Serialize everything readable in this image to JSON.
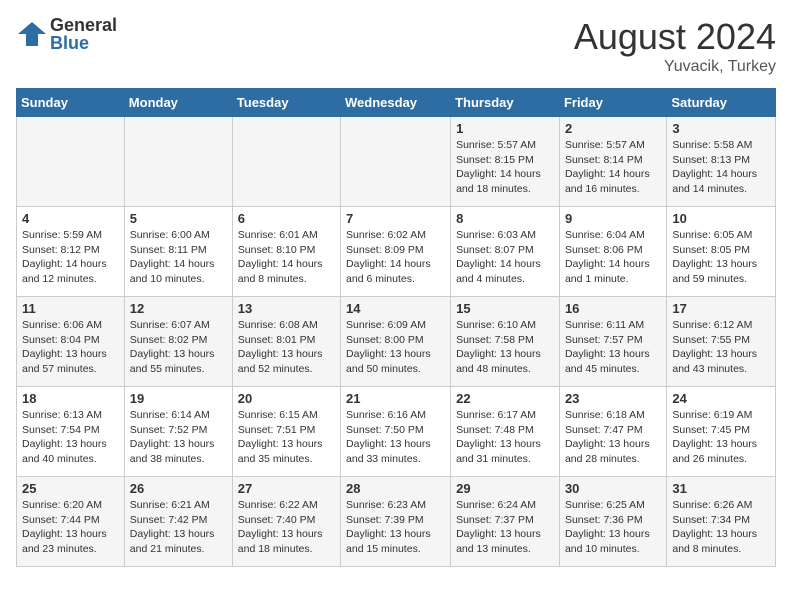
{
  "logo": {
    "general": "General",
    "blue": "Blue"
  },
  "title": "August 2024",
  "location": "Yuvacik, Turkey",
  "days_of_week": [
    "Sunday",
    "Monday",
    "Tuesday",
    "Wednesday",
    "Thursday",
    "Friday",
    "Saturday"
  ],
  "weeks": [
    [
      {
        "day": "",
        "content": ""
      },
      {
        "day": "",
        "content": ""
      },
      {
        "day": "",
        "content": ""
      },
      {
        "day": "",
        "content": ""
      },
      {
        "day": "1",
        "content": "Sunrise: 5:57 AM\nSunset: 8:15 PM\nDaylight: 14 hours\nand 18 minutes."
      },
      {
        "day": "2",
        "content": "Sunrise: 5:57 AM\nSunset: 8:14 PM\nDaylight: 14 hours\nand 16 minutes."
      },
      {
        "day": "3",
        "content": "Sunrise: 5:58 AM\nSunset: 8:13 PM\nDaylight: 14 hours\nand 14 minutes."
      }
    ],
    [
      {
        "day": "4",
        "content": "Sunrise: 5:59 AM\nSunset: 8:12 PM\nDaylight: 14 hours\nand 12 minutes."
      },
      {
        "day": "5",
        "content": "Sunrise: 6:00 AM\nSunset: 8:11 PM\nDaylight: 14 hours\nand 10 minutes."
      },
      {
        "day": "6",
        "content": "Sunrise: 6:01 AM\nSunset: 8:10 PM\nDaylight: 14 hours\nand 8 minutes."
      },
      {
        "day": "7",
        "content": "Sunrise: 6:02 AM\nSunset: 8:09 PM\nDaylight: 14 hours\nand 6 minutes."
      },
      {
        "day": "8",
        "content": "Sunrise: 6:03 AM\nSunset: 8:07 PM\nDaylight: 14 hours\nand 4 minutes."
      },
      {
        "day": "9",
        "content": "Sunrise: 6:04 AM\nSunset: 8:06 PM\nDaylight: 14 hours\nand 1 minute."
      },
      {
        "day": "10",
        "content": "Sunrise: 6:05 AM\nSunset: 8:05 PM\nDaylight: 13 hours\nand 59 minutes."
      }
    ],
    [
      {
        "day": "11",
        "content": "Sunrise: 6:06 AM\nSunset: 8:04 PM\nDaylight: 13 hours\nand 57 minutes."
      },
      {
        "day": "12",
        "content": "Sunrise: 6:07 AM\nSunset: 8:02 PM\nDaylight: 13 hours\nand 55 minutes."
      },
      {
        "day": "13",
        "content": "Sunrise: 6:08 AM\nSunset: 8:01 PM\nDaylight: 13 hours\nand 52 minutes."
      },
      {
        "day": "14",
        "content": "Sunrise: 6:09 AM\nSunset: 8:00 PM\nDaylight: 13 hours\nand 50 minutes."
      },
      {
        "day": "15",
        "content": "Sunrise: 6:10 AM\nSunset: 7:58 PM\nDaylight: 13 hours\nand 48 minutes."
      },
      {
        "day": "16",
        "content": "Sunrise: 6:11 AM\nSunset: 7:57 PM\nDaylight: 13 hours\nand 45 minutes."
      },
      {
        "day": "17",
        "content": "Sunrise: 6:12 AM\nSunset: 7:55 PM\nDaylight: 13 hours\nand 43 minutes."
      }
    ],
    [
      {
        "day": "18",
        "content": "Sunrise: 6:13 AM\nSunset: 7:54 PM\nDaylight: 13 hours\nand 40 minutes."
      },
      {
        "day": "19",
        "content": "Sunrise: 6:14 AM\nSunset: 7:52 PM\nDaylight: 13 hours\nand 38 minutes."
      },
      {
        "day": "20",
        "content": "Sunrise: 6:15 AM\nSunset: 7:51 PM\nDaylight: 13 hours\nand 35 minutes."
      },
      {
        "day": "21",
        "content": "Sunrise: 6:16 AM\nSunset: 7:50 PM\nDaylight: 13 hours\nand 33 minutes."
      },
      {
        "day": "22",
        "content": "Sunrise: 6:17 AM\nSunset: 7:48 PM\nDaylight: 13 hours\nand 31 minutes."
      },
      {
        "day": "23",
        "content": "Sunrise: 6:18 AM\nSunset: 7:47 PM\nDaylight: 13 hours\nand 28 minutes."
      },
      {
        "day": "24",
        "content": "Sunrise: 6:19 AM\nSunset: 7:45 PM\nDaylight: 13 hours\nand 26 minutes."
      }
    ],
    [
      {
        "day": "25",
        "content": "Sunrise: 6:20 AM\nSunset: 7:44 PM\nDaylight: 13 hours\nand 23 minutes."
      },
      {
        "day": "26",
        "content": "Sunrise: 6:21 AM\nSunset: 7:42 PM\nDaylight: 13 hours\nand 21 minutes."
      },
      {
        "day": "27",
        "content": "Sunrise: 6:22 AM\nSunset: 7:40 PM\nDaylight: 13 hours\nand 18 minutes."
      },
      {
        "day": "28",
        "content": "Sunrise: 6:23 AM\nSunset: 7:39 PM\nDaylight: 13 hours\nand 15 minutes."
      },
      {
        "day": "29",
        "content": "Sunrise: 6:24 AM\nSunset: 7:37 PM\nDaylight: 13 hours\nand 13 minutes."
      },
      {
        "day": "30",
        "content": "Sunrise: 6:25 AM\nSunset: 7:36 PM\nDaylight: 13 hours\nand 10 minutes."
      },
      {
        "day": "31",
        "content": "Sunrise: 6:26 AM\nSunset: 7:34 PM\nDaylight: 13 hours\nand 8 minutes."
      }
    ]
  ]
}
